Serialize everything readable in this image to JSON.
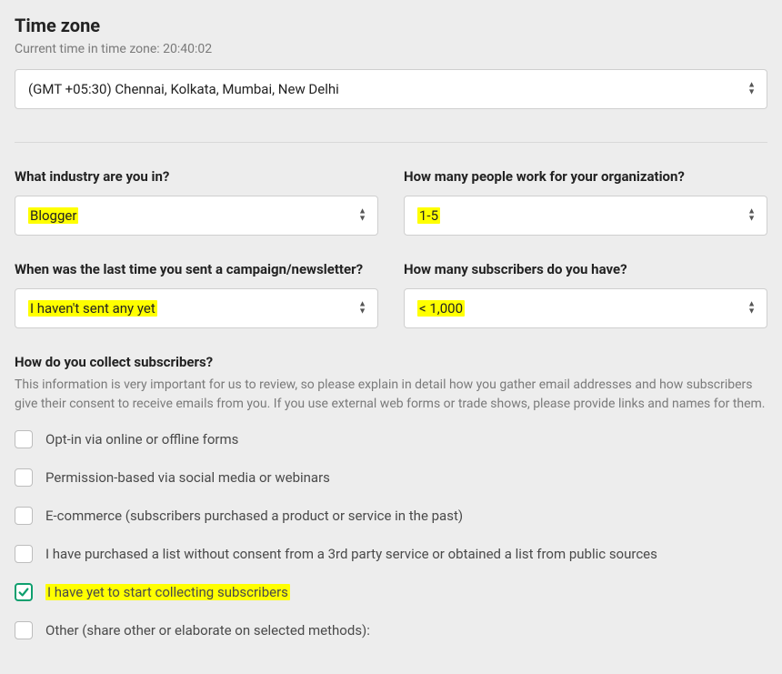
{
  "timezone": {
    "title": "Time zone",
    "current_time_label": "Current time in time zone: 20:40:02",
    "selected": "(GMT +05:30) Chennai, Kolkata, Mumbai, New Delhi"
  },
  "industry": {
    "label": "What industry are you in?",
    "value": "Blogger"
  },
  "org_size": {
    "label": "How many people work for your organization?",
    "value": "1-5"
  },
  "last_campaign": {
    "label": "When was the last time you sent a campaign/newsletter?",
    "value": "I haven't sent any yet"
  },
  "subscribers": {
    "label": "How many subscribers do you have?",
    "value": "< 1,000"
  },
  "collect": {
    "label": "How do you collect subscribers?",
    "help": "This information is very important for us to review, so please explain in detail how you gather email addresses and how subscribers give their consent to receive emails from you. If you use external web forms or trade shows, please provide links and names for them.",
    "options": [
      "Opt-in via online or offline forms",
      "Permission-based via social media or webinars",
      "E-commerce (subscribers purchased a product or service in the past)",
      "I have purchased a list without consent from a 3rd party service or obtained a list from public sources",
      "I have yet to start collecting subscribers",
      "Other (share other or elaborate on selected methods):"
    ]
  }
}
